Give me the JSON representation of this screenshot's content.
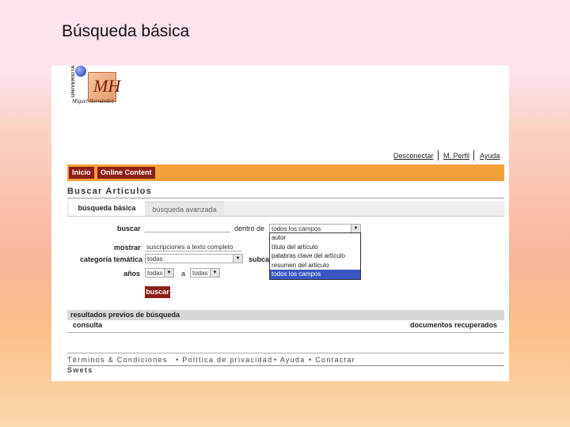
{
  "slide_title": "Búsqueda básica",
  "logo": {
    "vertical_text": "UNIVERSITAS",
    "name": "Miguel Hernández",
    "mark": "MH"
  },
  "top_links": [
    "Desconectar",
    "M. Perfil",
    "Ayuda"
  ],
  "nav": [
    "Inicio",
    "Online Content"
  ],
  "heading": "Buscar Articulos",
  "tabs": [
    "búsqueda básica",
    "búsqueda avanzada"
  ],
  "form": {
    "buscar_label": "buscar",
    "buscar_value": "",
    "dentro_label": "dentro de",
    "dentro_value": "todos los campos",
    "mostrar_label": "mostrar",
    "mostrar_value": "suscripciones a texto completo",
    "categoria_label": "categoría temática",
    "categoria_value": "todas",
    "subcat_label": "subcat",
    "anos_label": "años",
    "anos_from": "todas",
    "anos_a": "a",
    "anos_to": "todas",
    "button": "buscar"
  },
  "dropdown_options": [
    "autor",
    "título del artículo",
    "palabras clave del artículo",
    "resumen del artículo",
    "todos los campos"
  ],
  "dropdown_selected_index": 4,
  "results": {
    "title": "resultados previos de búsqueda",
    "col_left": "consulta",
    "col_right": "documentos recuperados"
  },
  "footer": {
    "links": [
      "Términos & Condiciones",
      "• Política de privacidad",
      "• Ayuda",
      "• Contactar"
    ],
    "brand": "Swets"
  },
  "colors": {
    "nav_bar": "#f5a13a",
    "nav_button": "#8d1d16",
    "selected_option": "#3a56c4"
  },
  "icons": {
    "select_arrow": "chevron-down-icon"
  }
}
